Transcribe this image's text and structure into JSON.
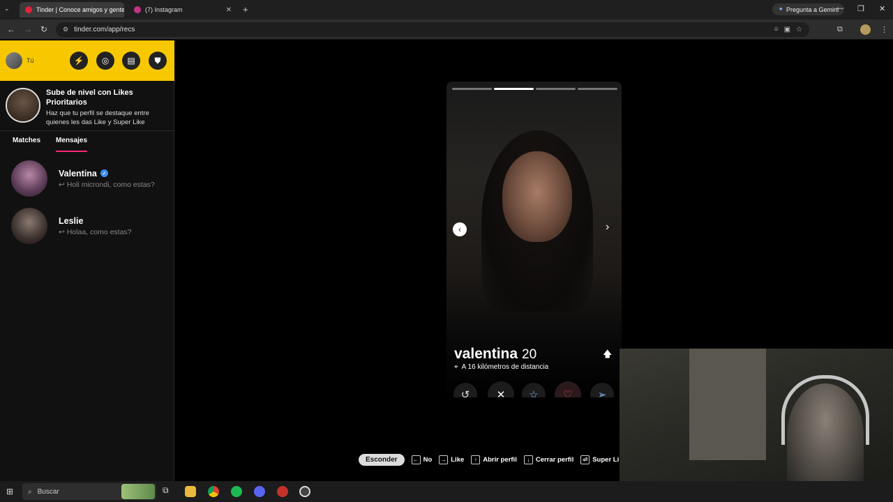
{
  "browser": {
    "tabs": [
      {
        "title": "Tinder | Conoce amigos y gente",
        "icon": "tinder-icon",
        "color": "#e0243a"
      },
      {
        "title": "(7) Instagram",
        "icon": "instagram-icon",
        "color": "#c13584"
      }
    ],
    "new_tab": "+",
    "gemini_label": "Pregunta a Gemini",
    "url": "tinder.com/app/recs"
  },
  "sidebar": {
    "user_label": "Tú",
    "header_icons": [
      "boost-icon",
      "explore-icon",
      "briefcase-icon",
      "shield-icon"
    ],
    "promo": {
      "title": "Sube de nivel con Likes Prioritarios",
      "subtitle": "Haz que tu perfil se destaque entre quienes les das Like y Super Like"
    },
    "tabs": {
      "matches": "Matches",
      "messages": "Mensajes"
    },
    "conversations": [
      {
        "name": "Valentina",
        "verified": true,
        "last_message": "Holi microndi, como estas?"
      },
      {
        "name": "Leslie",
        "verified": false,
        "last_message": "Holaa, como estas?"
      }
    ]
  },
  "card": {
    "name": "valentina",
    "age": "20",
    "distance": "A 16 kilómetros de distancia",
    "photo_count": 4,
    "current_photo": 2,
    "actions": [
      "rewind-icon",
      "nope-icon",
      "super-like-icon",
      "like-icon",
      "boost-send-icon"
    ]
  },
  "shortcuts": {
    "hide_label": "Esconder",
    "items": [
      {
        "key": "←",
        "label": "No"
      },
      {
        "key": "→",
        "label": "Like"
      },
      {
        "key": "↑",
        "label": "Abrir perfil"
      },
      {
        "key": "↓",
        "label": "Cerrar perfil"
      },
      {
        "key": "⏎",
        "label": "Super Li"
      }
    ]
  },
  "taskbar": {
    "search_placeholder": "Buscar"
  },
  "colors": {
    "tinder_yellow": "#f7c800",
    "accent_pink": "#fd267a",
    "like_red": "#ff4458",
    "superlike_blue": "#3b8ef3"
  }
}
